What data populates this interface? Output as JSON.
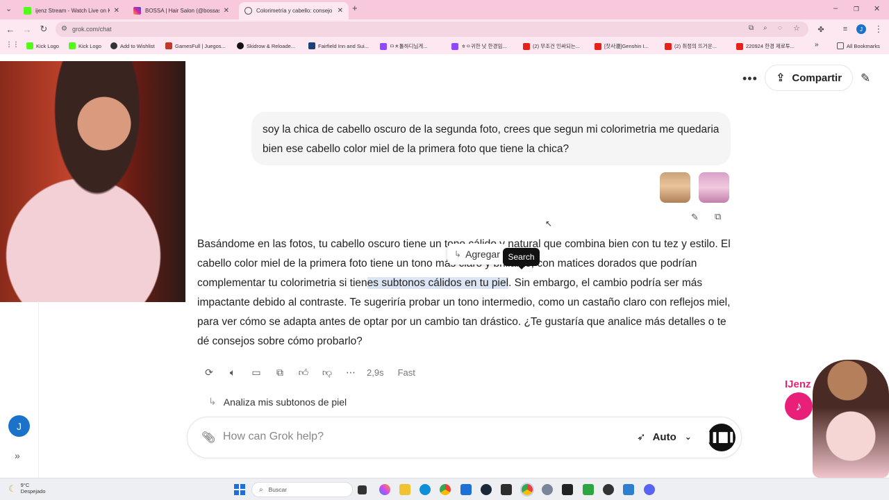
{
  "browser": {
    "tabs": [
      {
        "title": "ijenz Stream - Watch Live on Ki",
        "active": false
      },
      {
        "title": "BOSSA | Hair Salon (@bossasal",
        "active": false
      },
      {
        "title": "Colorimetría y cabello: consejo",
        "active": true
      }
    ],
    "new_tab": "+",
    "url": "grok.com/chat",
    "bookmarks": [
      "Kick Logo",
      "Kick Logo",
      "Add to Wishlist",
      "GamesFull | Juegos...",
      "Skidrow & Reloade...",
      "Fairfield Inn and Sui...",
      "ㅁㅊ톨하디님게...",
      "ㅎㅇ귀한 낫 한경임...",
      "(2) 무조건 인싸되는...",
      "[찻사漫]Genshin I...",
      "(2) 취정의 뜨거운...",
      "220924 한경 제로투..."
    ],
    "all_bookmarks": "All Bookmarks"
  },
  "header": {
    "share_label": "Compartir"
  },
  "user_message": "soy la chica de cabello oscuro de la segunda foto, crees que segun mi colorimetria me quedaria bien ese cabello color miel de la primera foto que tiene la chica?",
  "answer": {
    "part1": "Basándome en las fotos, tu cabello oscuro tiene un tono cálido y natural que combina bien con tu tez y estilo. El cabello color miel de la primera foto tiene un tono más claro y brillante, con matices dorados que podrían complementar tu colorimetria si tien",
    "highlight": "es subtonos cálidos en tu piel",
    "part2": ". Sin embargo, el cambio podría ser más impactante debido al contraste. Te sugeriría probar un tono intermedio, como un castaño claro con reflejos miel, para ver cómo se adapta antes de optar por un cambio tan drástico. ¿Te gustaría que analice más detalles o te dé consejos sobre cómo probarlo?"
  },
  "selection_popup": {
    "add_label": "Agregar",
    "tooltip": "Search"
  },
  "response_meta": {
    "time": "2,9s",
    "mode": "Fast"
  },
  "suggestion": "Analiza mis subtonos de piel",
  "composer": {
    "placeholder": "How can Grok help?",
    "model": "Auto"
  },
  "sidebar": {
    "avatar_initial": "J"
  },
  "overlay": {
    "streamer_name": "IJenz"
  },
  "taskbar": {
    "temperature": "9°C",
    "weather": "Despejado",
    "search_placeholder": "Buscar"
  },
  "colors": {
    "tab_strip": "#f8c8dc",
    "toolbar": "#fde7f0",
    "highlight": "#dbe5f3",
    "accent_blue": "#1a73c9"
  }
}
